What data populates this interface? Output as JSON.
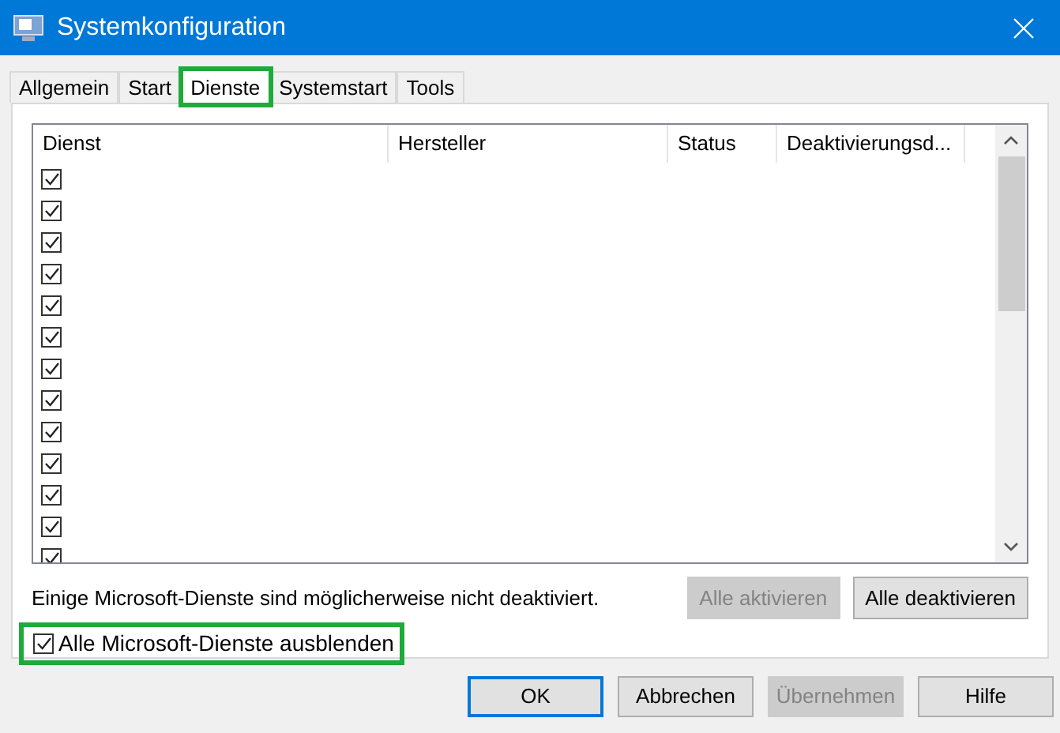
{
  "window": {
    "title": "Systemkonfiguration"
  },
  "tabs": [
    {
      "label": "Allgemein",
      "selected": false,
      "highlighted": false
    },
    {
      "label": "Start",
      "selected": false,
      "highlighted": false
    },
    {
      "label": "Dienste",
      "selected": true,
      "highlighted": true
    },
    {
      "label": "Systemstart",
      "selected": false,
      "highlighted": false
    },
    {
      "label": "Tools",
      "selected": false,
      "highlighted": false
    }
  ],
  "table": {
    "columns": [
      "Dienst",
      "Hersteller",
      "Status",
      "Deaktivierungsd..."
    ],
    "rows": [
      {
        "checked": true
      },
      {
        "checked": true
      },
      {
        "checked": true
      },
      {
        "checked": true
      },
      {
        "checked": true
      },
      {
        "checked": true
      },
      {
        "checked": true
      },
      {
        "checked": true
      },
      {
        "checked": true
      },
      {
        "checked": true
      },
      {
        "checked": true
      },
      {
        "checked": true
      },
      {
        "checked": true
      }
    ]
  },
  "note": "Einige Microsoft-Dienste sind möglicherweise nicht deaktiviert.",
  "list_buttons": [
    {
      "label": "Alle aktivieren",
      "disabled": true
    },
    {
      "label": "Alle deaktivieren",
      "disabled": false
    }
  ],
  "hide_ms": {
    "label": "Alle Microsoft-Dienste ausblenden",
    "checked": true,
    "highlighted": true
  },
  "buttons": [
    {
      "label": "OK",
      "disabled": false,
      "default": true
    },
    {
      "label": "Abbrechen",
      "disabled": false,
      "default": false
    },
    {
      "label": "Übernehmen",
      "disabled": true,
      "default": false
    },
    {
      "label": "Hilfe",
      "disabled": false,
      "default": false
    }
  ]
}
